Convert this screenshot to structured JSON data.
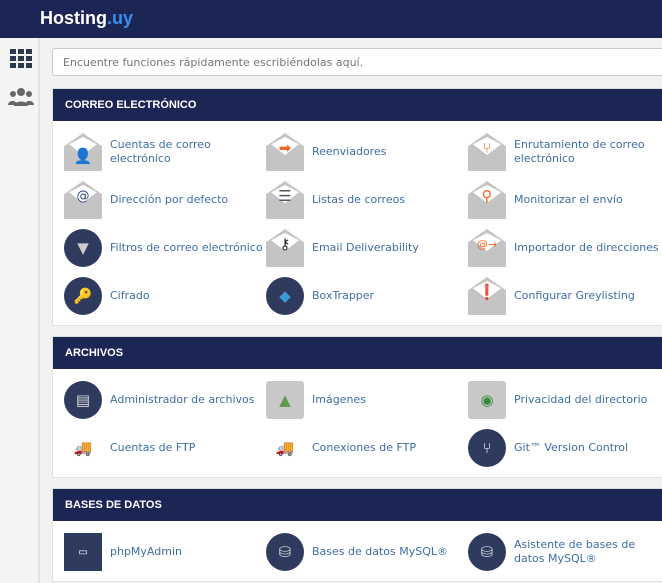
{
  "header": {
    "brand": "Hosting",
    "brand_suffix": ".uy"
  },
  "sidebar": {
    "items": [
      {
        "icon": "grid-icon"
      },
      {
        "icon": "users-icon"
      }
    ]
  },
  "search": {
    "placeholder": "Encuentre funciones rápidamente escribiéndolas aquí."
  },
  "sections": [
    {
      "title": "CORREO ELECTRÓNICO",
      "items": [
        {
          "label": "Cuentas de correo electrónico",
          "icon": "envelope-user-icon"
        },
        {
          "label": "Reenviadores",
          "icon": "envelope-arrow-icon"
        },
        {
          "label": "Enrutamiento de correo electrónico",
          "icon": "envelope-route-icon"
        },
        {
          "label": "Dirección por defecto",
          "icon": "envelope-at-icon"
        },
        {
          "label": "Listas de correos",
          "icon": "envelope-list-icon"
        },
        {
          "label": "Monitorizar el envío",
          "icon": "envelope-monitor-icon"
        },
        {
          "label": "Filtros de correo electrónico",
          "icon": "funnel-icon"
        },
        {
          "label": "Email Deliverability",
          "icon": "envelope-key-icon"
        },
        {
          "label": "Importador de direcciones",
          "icon": "envelope-import-icon"
        },
        {
          "label": "Cifrado",
          "icon": "key-icon"
        },
        {
          "label": "BoxTrapper",
          "icon": "boxtrapper-icon"
        },
        {
          "label": "Configurar Greylisting",
          "icon": "envelope-alert-icon"
        }
      ]
    },
    {
      "title": "ARCHIVOS",
      "items": [
        {
          "label": "Administrador de archivos",
          "icon": "file-cabinet-icon"
        },
        {
          "label": "Imágenes",
          "icon": "image-icon"
        },
        {
          "label": "Privacidad del directorio",
          "icon": "folder-eye-icon"
        },
        {
          "label": "Cuentas de FTP",
          "icon": "truck-user-icon"
        },
        {
          "label": "Conexiones de FTP",
          "icon": "truck-network-icon"
        },
        {
          "label": "Git™ Version Control",
          "icon": "git-icon"
        }
      ]
    },
    {
      "title": "BASES DE DATOS",
      "items": [
        {
          "label": "phpMyAdmin",
          "icon": "phpmyadmin-icon"
        },
        {
          "label": "Bases de datos MySQL®",
          "icon": "database-icon"
        },
        {
          "label": "Asistente de bases de datos MySQL®",
          "icon": "database-wizard-icon"
        }
      ]
    }
  ]
}
